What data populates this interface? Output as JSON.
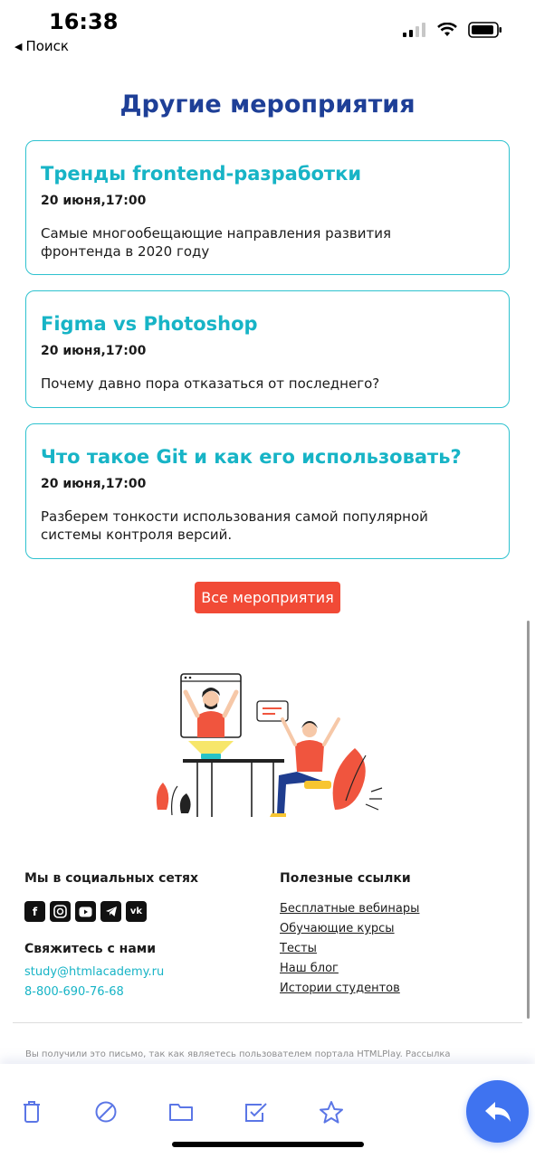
{
  "status_bar": {
    "time": "16:38",
    "back_label": "Поиск"
  },
  "title": "Другие мероприятия",
  "events": [
    {
      "title": "Тренды frontend-разработки",
      "date": "20 июня,17:00",
      "description": "Самые многообещающие направления развития фронтенда в 2020 году"
    },
    {
      "title": "Figma vs Photoshop",
      "date": "20 июня,17:00",
      "description": "Почему давно пора отказаться от последнего?"
    },
    {
      "title": "Что такое Git и как его использовать?",
      "date": "20 июня,17:00",
      "description": "Разберем тонкости использования самой популярной системы контроля версий."
    }
  ],
  "all_events_button": "Все мероприятия",
  "footer": {
    "social_heading": "Мы в социальных сетях",
    "social_icons": [
      "facebook-icon",
      "instagram-icon",
      "youtube-icon",
      "telegram-icon",
      "vk-icon"
    ],
    "contact_heading": "Свяжитесь с нами",
    "email": "study@htmlacademy.ru",
    "phone": "8-800-690-76-68",
    "links_heading": "Полезные ссылки",
    "links": [
      "Бесплатные вебинары",
      "Обучающие курсы",
      "Тесты",
      "Наш блог",
      "Истории студентов"
    ],
    "notice": "Вы получили это письмо, так как являетесь пользователем портала HTMLPlay. Рассылка производится"
  },
  "toolbar": {
    "items": [
      "trash-icon",
      "block-icon",
      "folder-icon",
      "mark-done-icon",
      "star-icon"
    ],
    "reply": "reply-icon"
  },
  "colors": {
    "title": "#1e3f97",
    "accent": "#17b4c6",
    "button": "#f14a36",
    "fab": "#3f73f0"
  }
}
